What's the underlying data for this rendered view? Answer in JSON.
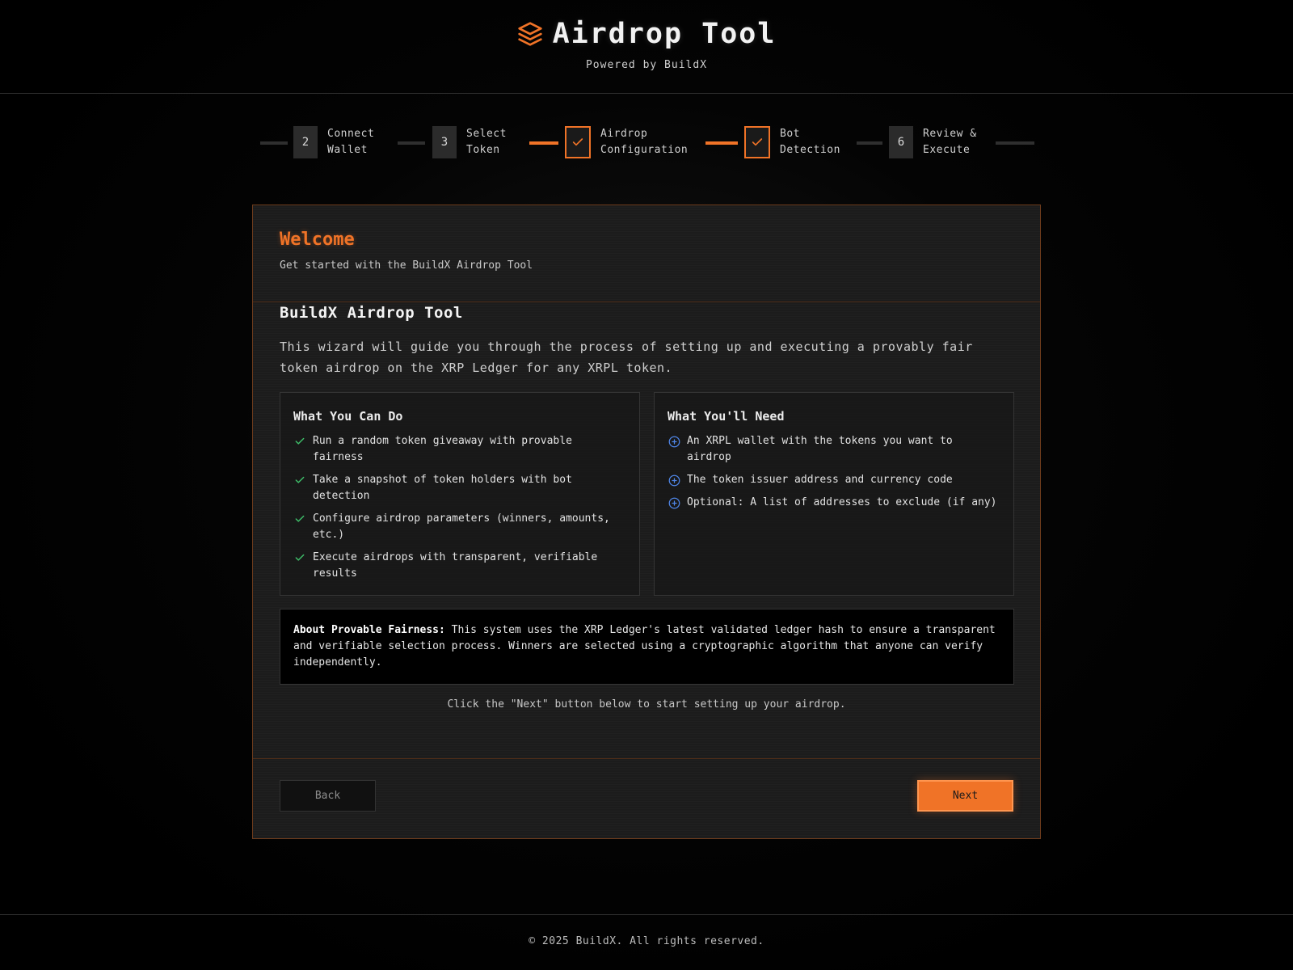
{
  "header": {
    "icon": "layers-icon",
    "title": "Airdrop Tool",
    "subtitle": "Powered by BuildX"
  },
  "stepper": {
    "steps": [
      {
        "marker": "2",
        "line1": "Connect",
        "line2": "Wallet",
        "state": "pending"
      },
      {
        "marker": "3",
        "line1": "Select",
        "line2": "Token",
        "state": "pending"
      },
      {
        "marker": "check-icon",
        "line1": "Airdrop",
        "line2": "Configuration",
        "state": "done"
      },
      {
        "marker": "check-icon",
        "line1": "Bot",
        "line2": "Detection",
        "state": "done"
      },
      {
        "marker": "6",
        "line1": "Review &",
        "line2": "Execute",
        "state": "pending"
      }
    ]
  },
  "card": {
    "title": "Welcome",
    "subtitle": "Get started with the BuildX Airdrop Tool",
    "section_title": "BuildX Airdrop Tool",
    "intro": "This wizard will guide you through the process of setting up and executing a provably fair token airdrop on the XRP Ledger for any XRPL token.",
    "can_do": {
      "title": "What You Can Do",
      "icon": "check-icon",
      "items": [
        "Run a random token giveaway with provable fairness",
        "Take a snapshot of token holders with bot detection",
        "Configure airdrop parameters (winners, amounts, etc.)",
        "Execute airdrops with transparent, verifiable results"
      ]
    },
    "need": {
      "title": "What You'll Need",
      "icon": "plus-circle-icon",
      "items": [
        "An XRPL wallet with the tokens you want to airdrop",
        "The token issuer address and currency code",
        "Optional: A list of addresses to exclude (if any)"
      ]
    },
    "fairness": {
      "label": "About Provable Fairness:",
      "text": " This system uses the XRP Ledger's latest validated ledger hash to ensure a transparent and verifiable selection process. Winners are selected using a cryptographic algorithm that anyone can verify independently."
    },
    "hint": "Click the \"Next\" button below to start setting up your airdrop.",
    "back_label": "Back",
    "next_label": "Next"
  },
  "footer": {
    "text": "© 2025 BuildX. All rights reserved."
  },
  "colors": {
    "accent": "#f07327",
    "check": "#3fbf6a",
    "info": "#4f86e8",
    "background": "#000000"
  }
}
